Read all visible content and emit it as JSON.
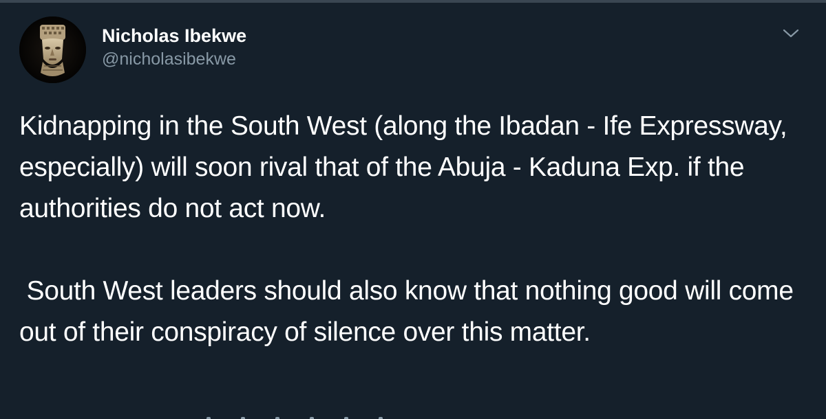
{
  "tweet": {
    "author": {
      "display_name": "Nicholas Ibekwe",
      "handle": "@nicholasibekwe",
      "avatar_icon": "mask-portrait-icon"
    },
    "menu_icon": "chevron-down-icon",
    "text": "Kidnapping in the South West (along the Ibadan - Ife Expressway, especially) will soon rival that of the Abuja - Kaduna Exp. if the authorities do not act now.\n\n South West leaders should also know that nothing good will come out of their conspiracy of silence over this matter."
  },
  "colors": {
    "background": "#15202b",
    "primary_text": "#ffffff",
    "secondary_text": "#8899a6",
    "divider": "#3a4652"
  }
}
